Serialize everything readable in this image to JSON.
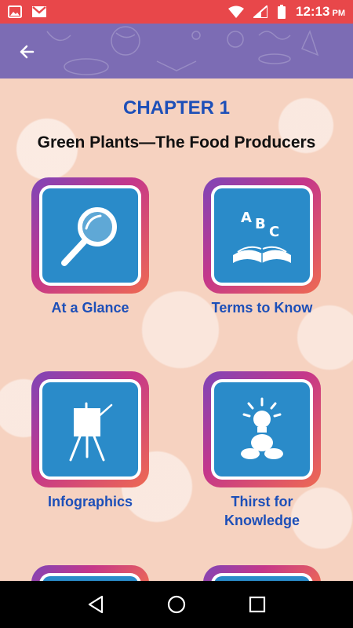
{
  "status_bar": {
    "time": "12:13",
    "meridiem": "PM",
    "icons": [
      "image-icon",
      "gmail-icon",
      "wifi-icon",
      "signal-icon",
      "battery-icon"
    ]
  },
  "toolbar": {
    "back_icon": "back-arrow-icon",
    "color": "#7c6cb4"
  },
  "chapter": {
    "number": "CHAPTER 1",
    "title": "Green Plants—The Food Producers"
  },
  "tiles": [
    {
      "label": "At a Glance",
      "icon": "magnifier-icon"
    },
    {
      "label": "Terms to Know",
      "icon": "abc-book-icon"
    },
    {
      "label": "Infographics",
      "icon": "easel-icon"
    },
    {
      "label": "Thirst for\nKnowledge",
      "icon": "lightbulb-person-icon"
    }
  ],
  "nav_bar": {
    "icons": [
      "back-triangle-icon",
      "home-circle-icon",
      "recents-square-icon"
    ]
  },
  "colors": {
    "status_bar": "#e8474a",
    "heading_blue": "#1d4fb8",
    "tile_panel": "#2a8bc9",
    "tile_gradient": [
      "#7e45b8",
      "#c5378a",
      "#ee6a52"
    ]
  }
}
